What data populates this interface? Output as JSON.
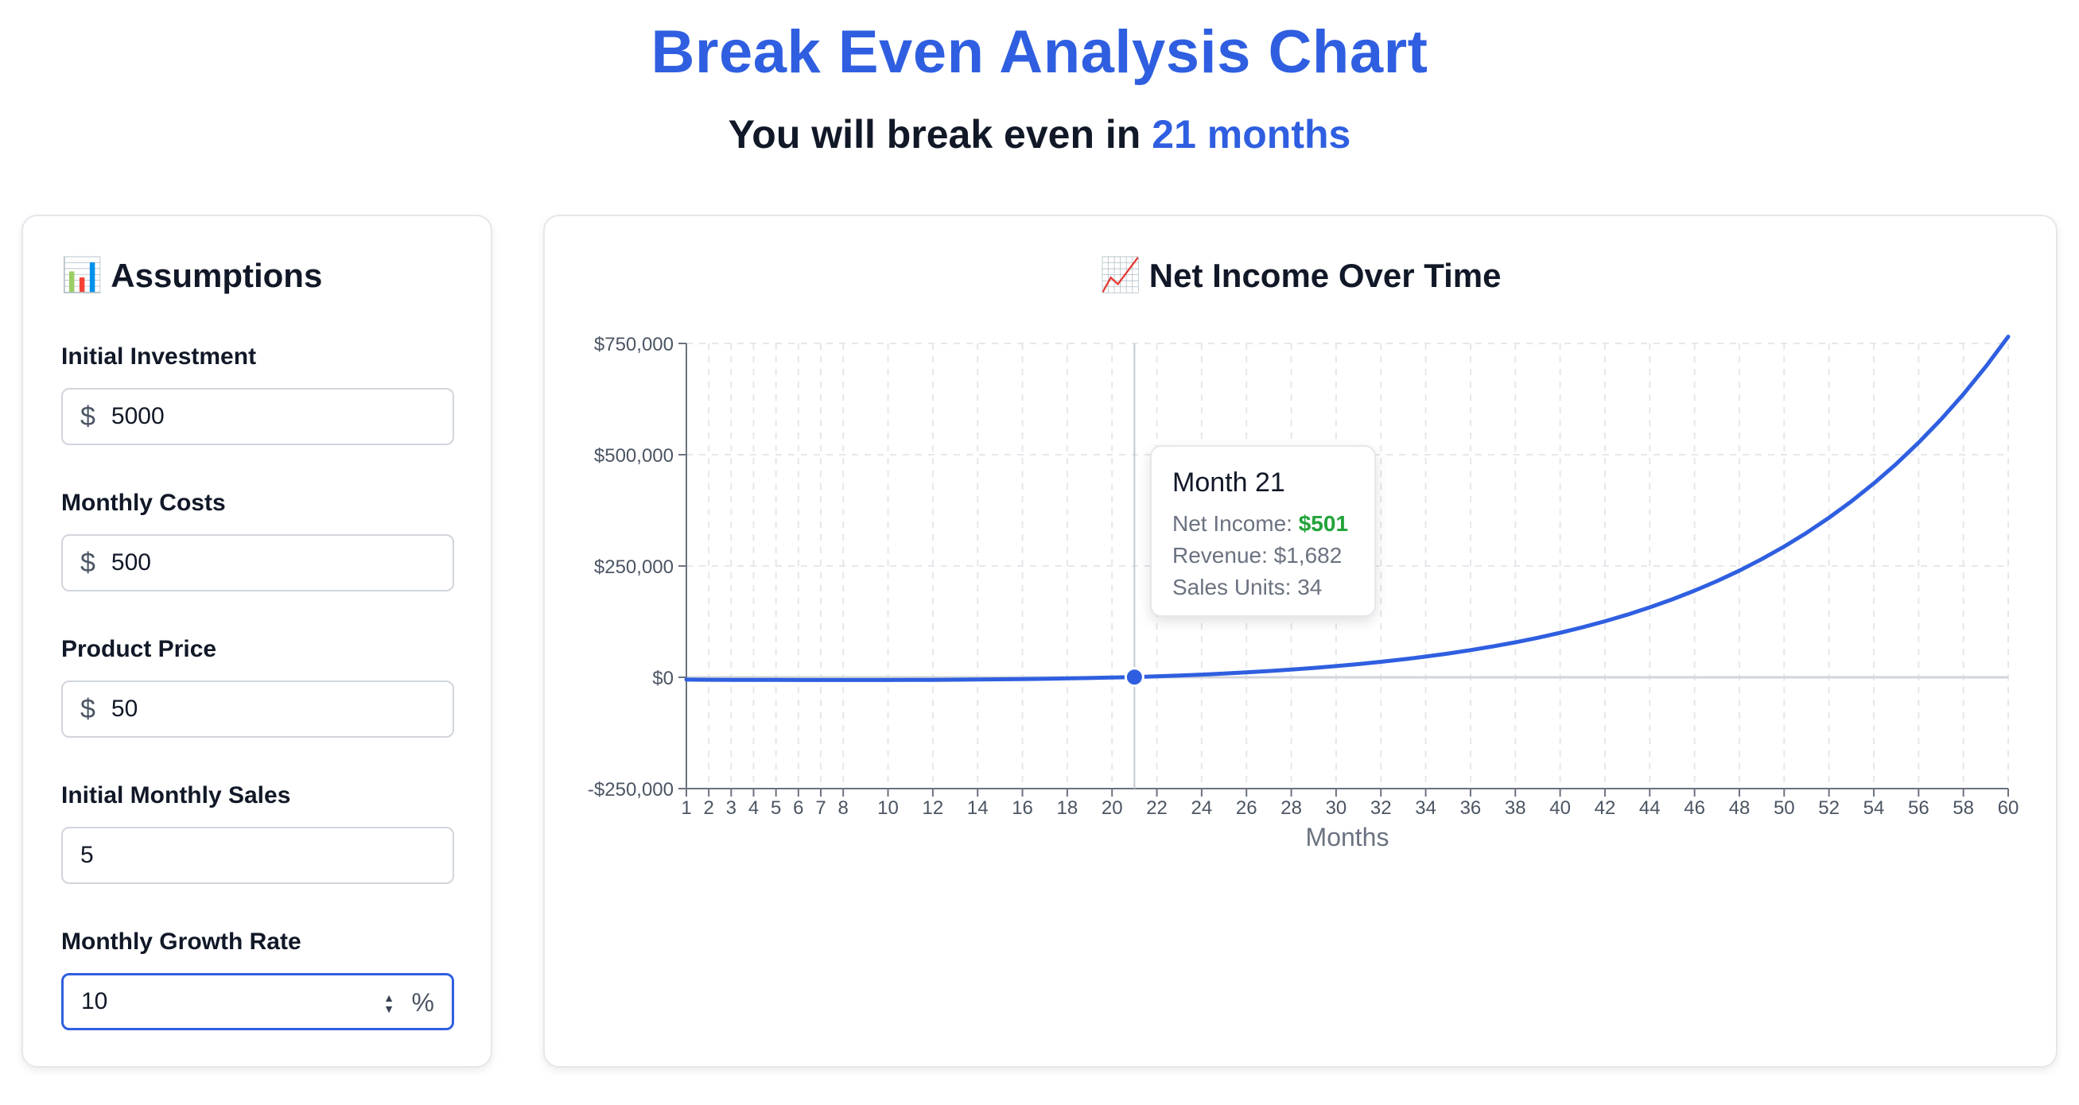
{
  "header": {
    "title": "Break Even Analysis Chart",
    "subtitle_prefix": "You will break even in",
    "subtitle_highlight": "21 months"
  },
  "assumptions": {
    "heading_icon": "📊",
    "heading": "Assumptions",
    "fields": [
      {
        "label": "Initial Investment",
        "prefix": "$",
        "value": "5000"
      },
      {
        "label": "Monthly Costs",
        "prefix": "$",
        "value": "500"
      },
      {
        "label": "Product Price",
        "prefix": "$",
        "value": "50"
      },
      {
        "label": "Initial Monthly Sales",
        "prefix": "",
        "value": "5"
      },
      {
        "label": "Monthly Growth Rate",
        "prefix": "",
        "value": "10",
        "suffix": "%"
      }
    ]
  },
  "chart": {
    "heading_icon": "📈",
    "heading": "Net Income Over Time"
  },
  "tooltip": {
    "title": "Month 21",
    "net_income_label": "Net Income:",
    "net_income_value": "$501",
    "revenue_label": "Revenue:",
    "revenue_value": "$1,682",
    "sales_label": "Sales Units:",
    "sales_value": "34"
  },
  "colors": {
    "accent": "#2f5fe0",
    "positive": "#22a33a",
    "line": "#2f5fe0"
  },
  "chart_data": {
    "type": "line",
    "xlabel": "Months",
    "ylabel": "",
    "xlim": [
      1,
      60
    ],
    "ylim": [
      -250000,
      750000
    ],
    "y_ticks": [
      -250000,
      0,
      250000,
      500000,
      750000
    ],
    "y_tick_labels": [
      "-$250,000",
      "$0",
      "$250,000",
      "$500,000",
      "$750,000"
    ],
    "x_tick_labels": [
      1,
      2,
      3,
      4,
      5,
      6,
      7,
      8,
      10,
      12,
      14,
      16,
      18,
      20,
      22,
      24,
      26,
      28,
      30,
      32,
      34,
      36,
      38,
      40,
      42,
      44,
      46,
      48,
      50,
      52,
      54,
      56,
      58,
      60
    ],
    "grid": true,
    "highlight_point": {
      "x": 21,
      "y": 501
    },
    "series": [
      {
        "x": [
          1,
          2,
          3,
          4,
          5,
          6,
          7,
          8,
          9,
          10,
          11,
          12,
          13,
          14,
          15,
          16,
          17,
          18,
          19,
          20,
          21,
          22,
          23,
          24,
          25,
          26,
          27,
          28,
          29,
          30,
          31,
          32,
          33,
          34,
          35,
          36,
          37,
          38,
          39,
          40,
          41,
          42,
          43,
          44,
          45,
          46,
          47,
          48,
          49,
          50,
          51,
          52,
          53,
          54,
          55,
          56,
          57,
          58,
          59,
          60
        ],
        "values": [
          -5250,
          -5475,
          -5673,
          -5840,
          -5974,
          -6072,
          -6129,
          -6142,
          -6106,
          -6017,
          -5868,
          -5654,
          -5368,
          -5002,
          -4545,
          -3988,
          -3316,
          -2518,
          -1577,
          -476,
          501,
          2138,
          3990,
          6080,
          8431,
          11070,
          14025,
          17327,
          21011,
          25113,
          29674,
          34737,
          40350,
          46566,
          53440,
          61033,
          69412,
          78650,
          88826,
          100026,
          112345,
          125885,
          140756,
          157078,
          174983,
          194615,
          216132,
          239703,
          265509,
          293745,
          324622,
          358366,
          395222,
          435453,
          479342,
          527192,
          579332,
          636115,
          697923,
          765170
        ]
      }
    ]
  }
}
